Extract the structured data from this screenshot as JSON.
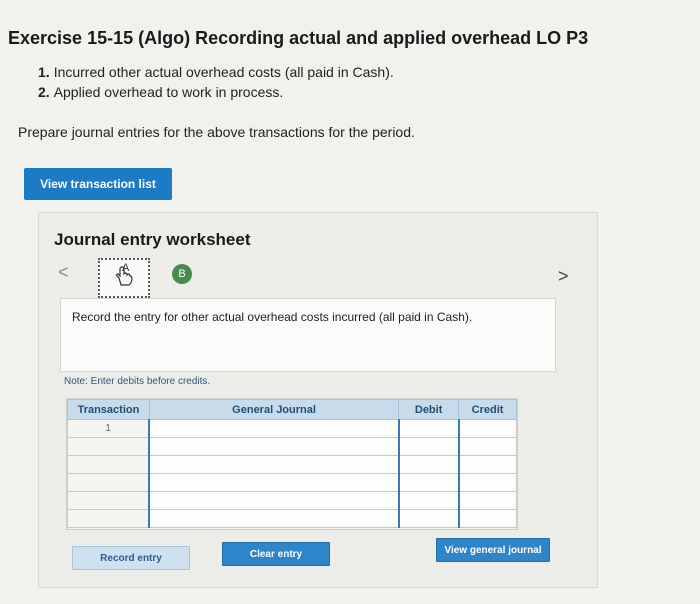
{
  "exercise": {
    "title": "Exercise 15-15 (Algo) Recording actual and applied overhead LO P3",
    "steps": [
      {
        "num": "1.",
        "text": "Incurred other actual overhead costs (all paid in Cash)."
      },
      {
        "num": "2.",
        "text": "Applied overhead to work in process."
      }
    ],
    "prompt": "Prepare journal entries for the above transactions for the period."
  },
  "toolbar": {
    "view_transactions_label": "View transaction list"
  },
  "worksheet": {
    "title": "Journal entry worksheet",
    "tile_a_label": "A",
    "tile_b_label": "B",
    "prev_label": "<",
    "next_label": ">",
    "instruction": "Record the entry for other actual overhead costs incurred (all paid in Cash).",
    "note": "Note: Enter debits before credits."
  },
  "journal": {
    "headers": [
      "Transaction",
      "General Journal",
      "Debit",
      "Credit"
    ],
    "rows": [
      {
        "transaction": "1",
        "account": "",
        "debit": "",
        "credit": ""
      },
      {
        "transaction": "",
        "account": "",
        "debit": "",
        "credit": ""
      },
      {
        "transaction": "",
        "account": "",
        "debit": "",
        "credit": ""
      },
      {
        "transaction": "",
        "account": "",
        "debit": "",
        "credit": ""
      },
      {
        "transaction": "",
        "account": "",
        "debit": "",
        "credit": ""
      },
      {
        "transaction": "",
        "account": "",
        "debit": "",
        "credit": ""
      }
    ]
  },
  "buttons": {
    "record_entry": "Record entry",
    "clear_entry": "Clear entry",
    "view_general_journal": "View general journal"
  },
  "colors": {
    "accent": "#2e85c9",
    "header_bg": "#c7dbea"
  }
}
